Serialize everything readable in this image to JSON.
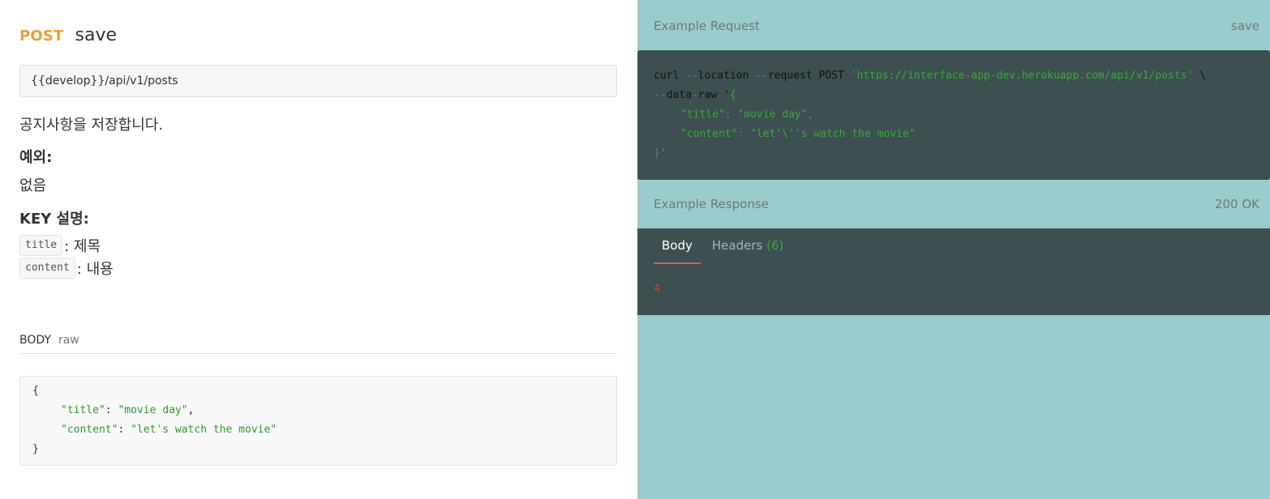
{
  "request": {
    "method": "POST",
    "name": "save",
    "url": "{{develop}}/api/v1/posts",
    "description": "공지사항을 저장합니다.",
    "exceptions_heading": "예외:",
    "exceptions_value": "없음",
    "keys_heading": "KEY 설명:",
    "keys": [
      {
        "key": "title",
        "desc": ": 제목"
      },
      {
        "key": "content",
        "desc": ": 내용"
      }
    ],
    "body_label": "BODY",
    "body_type": "raw",
    "body_lines": {
      "open": "{",
      "title_key": "\"title\"",
      "title_sep": ": ",
      "title_val": "\"movie day\"",
      "title_end": ",",
      "content_key": "\"content\"",
      "content_sep": ": ",
      "content_val": "\"let's watch the movie\"",
      "close": "}"
    }
  },
  "example_request": {
    "heading": "Example Request",
    "name": "save",
    "curl": {
      "l1_a": "curl ",
      "l1_dash1": "--",
      "l1_b": "location ",
      "l1_dash2": "--",
      "l1_c": "request POST ",
      "l1_url": "'https://interface-app-dev.herokuapp.com/api/v1/posts'",
      "l1_end": " \\",
      "l2_dash": "--",
      "l2_a": "data",
      "l2_dash2": "-",
      "l2_b": "raw '",
      "l2_brace": "{",
      "l3_key": "\"title\"",
      "l3_sep": ": ",
      "l3_val": "\"movie day\"",
      "l3_end": ",",
      "l4_key": "\"content\"",
      "l4_sep": ": ",
      "l4_val": "\"let'\\''s watch the movie\"",
      "l5_brace": "}",
      "l5_end": "'"
    }
  },
  "example_response": {
    "heading": "Example Response",
    "status": "200 OK",
    "tabs": {
      "body": "Body",
      "headers": "Headers",
      "headers_count": "(6)"
    },
    "body_value": "4"
  },
  "colors": {
    "method": "#f0a030",
    "right_bg": "#9acccd",
    "code_bg": "#3d4f51",
    "active_tab_underline": "#e25a4c",
    "string_green": "#339933",
    "response_value": "#d0423b"
  }
}
